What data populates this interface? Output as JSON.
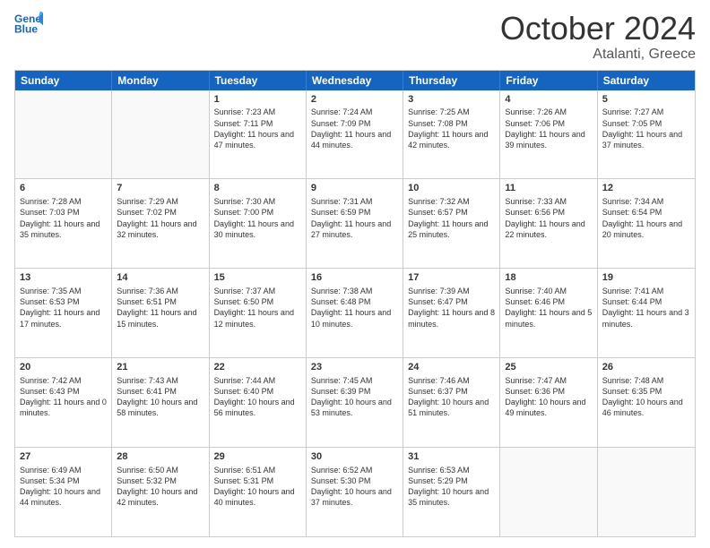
{
  "header": {
    "logo_line1": "General",
    "logo_line2": "Blue",
    "month_title": "October 2024",
    "location": "Atalanti, Greece"
  },
  "days_of_week": [
    "Sunday",
    "Monday",
    "Tuesday",
    "Wednesday",
    "Thursday",
    "Friday",
    "Saturday"
  ],
  "weeks": [
    [
      {
        "day": "",
        "info": ""
      },
      {
        "day": "",
        "info": ""
      },
      {
        "day": "1",
        "info": "Sunrise: 7:23 AM\nSunset: 7:11 PM\nDaylight: 11 hours and 47 minutes."
      },
      {
        "day": "2",
        "info": "Sunrise: 7:24 AM\nSunset: 7:09 PM\nDaylight: 11 hours and 44 minutes."
      },
      {
        "day": "3",
        "info": "Sunrise: 7:25 AM\nSunset: 7:08 PM\nDaylight: 11 hours and 42 minutes."
      },
      {
        "day": "4",
        "info": "Sunrise: 7:26 AM\nSunset: 7:06 PM\nDaylight: 11 hours and 39 minutes."
      },
      {
        "day": "5",
        "info": "Sunrise: 7:27 AM\nSunset: 7:05 PM\nDaylight: 11 hours and 37 minutes."
      }
    ],
    [
      {
        "day": "6",
        "info": "Sunrise: 7:28 AM\nSunset: 7:03 PM\nDaylight: 11 hours and 35 minutes."
      },
      {
        "day": "7",
        "info": "Sunrise: 7:29 AM\nSunset: 7:02 PM\nDaylight: 11 hours and 32 minutes."
      },
      {
        "day": "8",
        "info": "Sunrise: 7:30 AM\nSunset: 7:00 PM\nDaylight: 11 hours and 30 minutes."
      },
      {
        "day": "9",
        "info": "Sunrise: 7:31 AM\nSunset: 6:59 PM\nDaylight: 11 hours and 27 minutes."
      },
      {
        "day": "10",
        "info": "Sunrise: 7:32 AM\nSunset: 6:57 PM\nDaylight: 11 hours and 25 minutes."
      },
      {
        "day": "11",
        "info": "Sunrise: 7:33 AM\nSunset: 6:56 PM\nDaylight: 11 hours and 22 minutes."
      },
      {
        "day": "12",
        "info": "Sunrise: 7:34 AM\nSunset: 6:54 PM\nDaylight: 11 hours and 20 minutes."
      }
    ],
    [
      {
        "day": "13",
        "info": "Sunrise: 7:35 AM\nSunset: 6:53 PM\nDaylight: 11 hours and 17 minutes."
      },
      {
        "day": "14",
        "info": "Sunrise: 7:36 AM\nSunset: 6:51 PM\nDaylight: 11 hours and 15 minutes."
      },
      {
        "day": "15",
        "info": "Sunrise: 7:37 AM\nSunset: 6:50 PM\nDaylight: 11 hours and 12 minutes."
      },
      {
        "day": "16",
        "info": "Sunrise: 7:38 AM\nSunset: 6:48 PM\nDaylight: 11 hours and 10 minutes."
      },
      {
        "day": "17",
        "info": "Sunrise: 7:39 AM\nSunset: 6:47 PM\nDaylight: 11 hours and 8 minutes."
      },
      {
        "day": "18",
        "info": "Sunrise: 7:40 AM\nSunset: 6:46 PM\nDaylight: 11 hours and 5 minutes."
      },
      {
        "day": "19",
        "info": "Sunrise: 7:41 AM\nSunset: 6:44 PM\nDaylight: 11 hours and 3 minutes."
      }
    ],
    [
      {
        "day": "20",
        "info": "Sunrise: 7:42 AM\nSunset: 6:43 PM\nDaylight: 11 hours and 0 minutes."
      },
      {
        "day": "21",
        "info": "Sunrise: 7:43 AM\nSunset: 6:41 PM\nDaylight: 10 hours and 58 minutes."
      },
      {
        "day": "22",
        "info": "Sunrise: 7:44 AM\nSunset: 6:40 PM\nDaylight: 10 hours and 56 minutes."
      },
      {
        "day": "23",
        "info": "Sunrise: 7:45 AM\nSunset: 6:39 PM\nDaylight: 10 hours and 53 minutes."
      },
      {
        "day": "24",
        "info": "Sunrise: 7:46 AM\nSunset: 6:37 PM\nDaylight: 10 hours and 51 minutes."
      },
      {
        "day": "25",
        "info": "Sunrise: 7:47 AM\nSunset: 6:36 PM\nDaylight: 10 hours and 49 minutes."
      },
      {
        "day": "26",
        "info": "Sunrise: 7:48 AM\nSunset: 6:35 PM\nDaylight: 10 hours and 46 minutes."
      }
    ],
    [
      {
        "day": "27",
        "info": "Sunrise: 6:49 AM\nSunset: 5:34 PM\nDaylight: 10 hours and 44 minutes."
      },
      {
        "day": "28",
        "info": "Sunrise: 6:50 AM\nSunset: 5:32 PM\nDaylight: 10 hours and 42 minutes."
      },
      {
        "day": "29",
        "info": "Sunrise: 6:51 AM\nSunset: 5:31 PM\nDaylight: 10 hours and 40 minutes."
      },
      {
        "day": "30",
        "info": "Sunrise: 6:52 AM\nSunset: 5:30 PM\nDaylight: 10 hours and 37 minutes."
      },
      {
        "day": "31",
        "info": "Sunrise: 6:53 AM\nSunset: 5:29 PM\nDaylight: 10 hours and 35 minutes."
      },
      {
        "day": "",
        "info": ""
      },
      {
        "day": "",
        "info": ""
      }
    ]
  ]
}
